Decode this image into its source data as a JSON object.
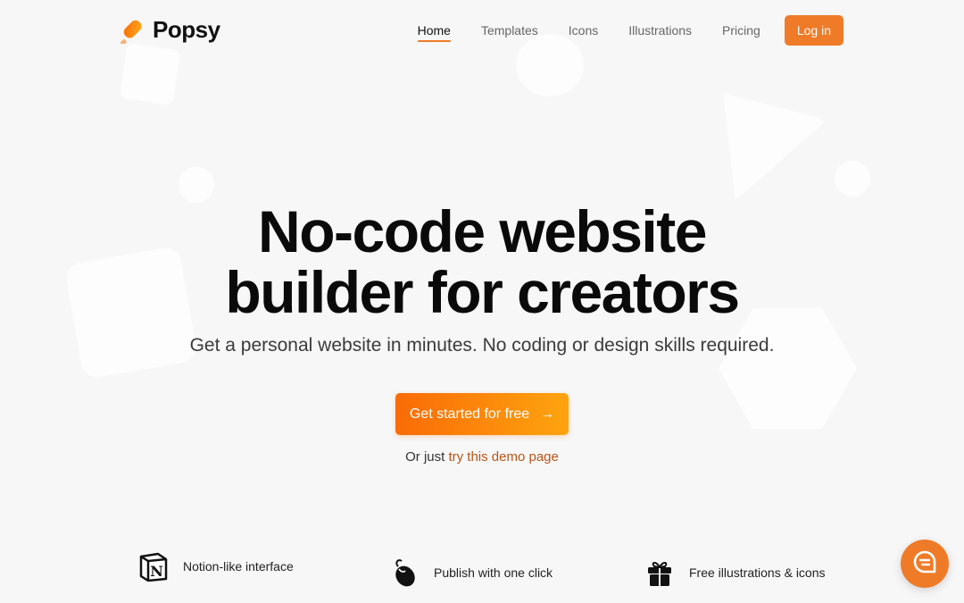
{
  "brand": {
    "name": "Popsy",
    "accent": "#ef7b28",
    "logo_icon": "popsicle-icon"
  },
  "nav": {
    "items": [
      {
        "label": "Home",
        "active": true
      },
      {
        "label": "Templates",
        "active": false
      },
      {
        "label": "Icons",
        "active": false
      },
      {
        "label": "Illustrations",
        "active": false
      },
      {
        "label": "Pricing",
        "active": false
      }
    ],
    "login_label": "Log in"
  },
  "hero": {
    "title_line1": "No-code website",
    "title_line2": "builder for creators",
    "subtitle": "Get a personal website in minutes. No coding or design skills required.",
    "cta_label": "Get started for free",
    "cta_icon": "arrow-right-icon",
    "cta_arrow": "→",
    "demo_prefix": "Or just",
    "demo_link": "try this demo page"
  },
  "features": [
    {
      "icon": "notion-icon",
      "label": "Notion-like interface"
    },
    {
      "icon": "mouse-click-icon",
      "label": "Publish with one click"
    },
    {
      "icon": "gift-icon",
      "label": "Free illustrations & icons"
    }
  ],
  "chat": {
    "icon": "chat-bubble-icon"
  }
}
